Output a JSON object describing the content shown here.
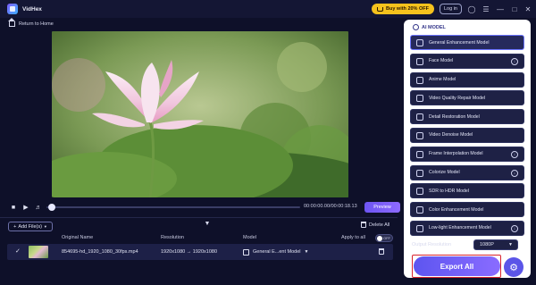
{
  "app": {
    "name": "VidHex"
  },
  "titlebar": {
    "buy_label": "Buy with 20% OFF",
    "login_label": "Log in",
    "icons": [
      "user-icon",
      "menu-icon",
      "minimize-icon",
      "maximize-icon",
      "close-icon"
    ]
  },
  "nav": {
    "return_label": "Return to Home"
  },
  "playback": {
    "time": "00:00:00.00/00:00:18.13",
    "preview_label": "Preview"
  },
  "toolbar": {
    "add_files_label": "Add File(s)",
    "delete_all_label": "Delete All"
  },
  "table": {
    "headers": [
      "Original Name",
      "Resolution",
      "Model",
      "Apply to all"
    ],
    "apply_toggle": "OFF",
    "rows": [
      {
        "name": "854695-hd_1920_1080_30fps.mp4",
        "resolution": "1920x1080 → 1920x1080",
        "model": "General E...ent Model"
      }
    ]
  },
  "panel": {
    "title": "AI MODEL",
    "models": [
      {
        "label": "General Enhancement Model",
        "selected": true,
        "download": false
      },
      {
        "label": "Face Model",
        "selected": false,
        "download": true
      },
      {
        "label": "Anime Model",
        "selected": false,
        "download": false
      },
      {
        "label": "Video Quality Repair Model",
        "selected": false,
        "download": false
      },
      {
        "label": "Detail Restoration Model",
        "selected": false,
        "download": false
      },
      {
        "label": "Video Denoise Model",
        "selected": false,
        "download": false
      },
      {
        "label": "Frame Interpolation Model",
        "selected": false,
        "download": true
      },
      {
        "label": "Colorize Model",
        "selected": false,
        "download": true
      },
      {
        "label": "SDR to HDR Model",
        "selected": false,
        "download": false
      },
      {
        "label": "Color Enhancement Model",
        "selected": false,
        "download": false
      },
      {
        "label": "Low-light Enhancement Model",
        "selected": false,
        "download": true
      }
    ],
    "output_resolution_label": "Output Resolution",
    "output_resolution_value": "1080P",
    "export_label": "Export All"
  },
  "colors": {
    "accent": "#6d55f2",
    "buy": "#f6c21d",
    "highlight": "#d9232e"
  }
}
